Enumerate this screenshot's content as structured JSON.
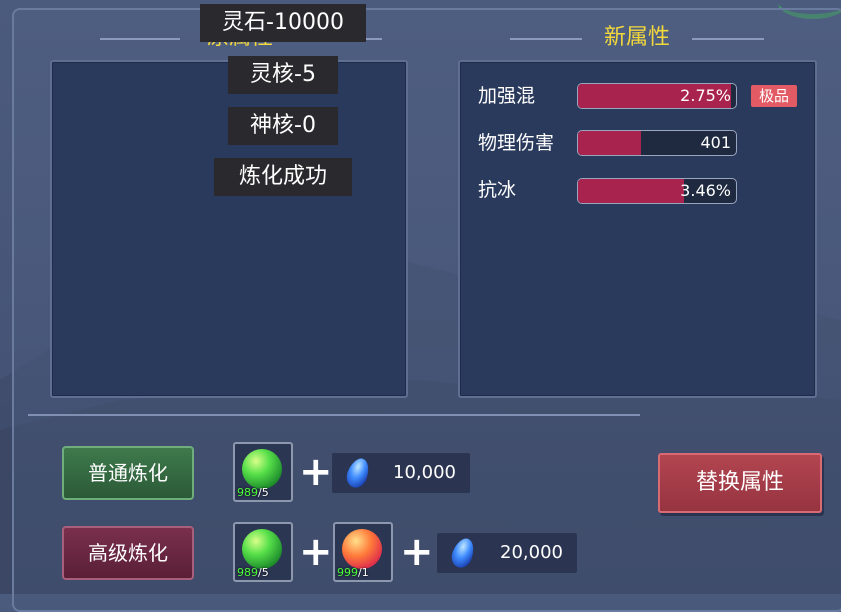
{
  "sections": {
    "old_title": "原属性",
    "new_title": "新属性"
  },
  "new_attributes": [
    {
      "label": "加强混",
      "value_text": "2.75%",
      "fill": 0.97
    },
    {
      "label": "物理伤害",
      "value_text": "401",
      "fill": 0.4
    },
    {
      "label": "抗冰",
      "value_text": "3.46%",
      "fill": 0.67
    }
  ],
  "quality_badge": "极品",
  "toasts": [
    "灵石-10000",
    "灵核-5",
    "神核-0",
    "炼化成功"
  ],
  "buttons": {
    "normal": "普通炼化",
    "advanced": "高级炼化",
    "replace": "替换属性"
  },
  "normal_cost": {
    "item1": {
      "icon": "green-core-orb",
      "have": "989",
      "need": "/5"
    },
    "stones": {
      "icon": "blue-spirit-stone-icon",
      "amount": "10,000"
    }
  },
  "advanced_cost": {
    "item1": {
      "icon": "green-core-orb",
      "have": "989",
      "need": "/5"
    },
    "item2": {
      "icon": "red-divine-core-orb",
      "have": "999",
      "need": "/1"
    },
    "stones": {
      "icon": "blue-spirit-stone-icon",
      "amount": "20,000"
    }
  },
  "plus_sign": "+",
  "colors": {
    "title_yellow": "#f3d83c",
    "bar_fill": "#a9234f",
    "badge": "#e25a64",
    "count_green": "#4cff3c"
  }
}
